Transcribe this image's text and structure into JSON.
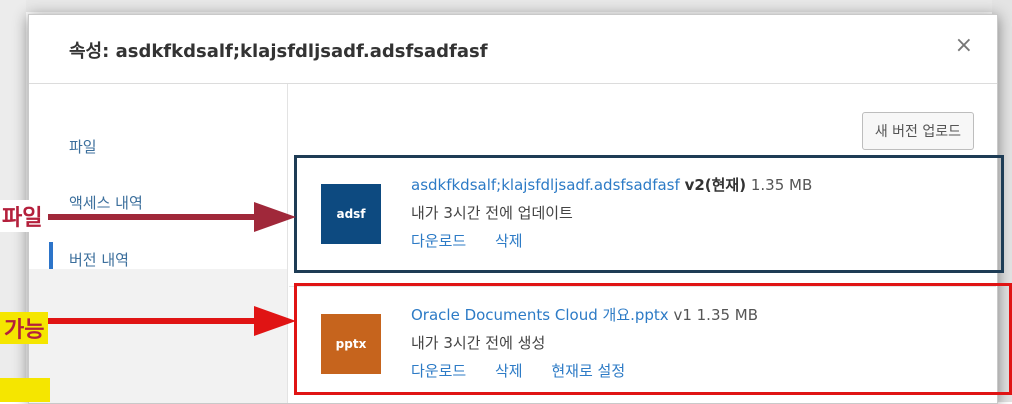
{
  "dialog": {
    "title": "속성: asdkfkdsalf;klajsfdljsadf.adsfsadfasf",
    "close_icon": "close-icon"
  },
  "sidebar": {
    "items": [
      {
        "label": "파일"
      },
      {
        "label": "액세스 내역"
      },
      {
        "label": "버전 내역"
      }
    ],
    "active_index": 2
  },
  "main": {
    "upload_button": "새 버전 업로드",
    "versions": [
      {
        "thumb_label": "adsf",
        "thumb_color": "#0d4a80",
        "filename": "asdkfkdsalf;klajsfdljsadf.adsfsadfasf",
        "version": "v2(현재)",
        "size": "1.35 MB",
        "subtext": "내가 3시간 전에 업데이트",
        "actions": [
          "다운로드",
          "삭제"
        ]
      },
      {
        "thumb_label": "pptx",
        "thumb_color": "#c6641d",
        "filename": "Oracle Documents Cloud 개요.pptx",
        "version": "v1",
        "size": "1.35 MB",
        "subtext": "내가 3시간 전에 생성",
        "actions": [
          "다운로드",
          "삭제",
          "현재로 설정"
        ]
      }
    ]
  },
  "annotations": {
    "label_file": "파일",
    "label_possible": "가능",
    "dark_box_color": "#1e3c55",
    "red_box_color": "#e01414",
    "arrow_dark_color": "#a0283a",
    "arrow_red_color": "#e01414"
  }
}
